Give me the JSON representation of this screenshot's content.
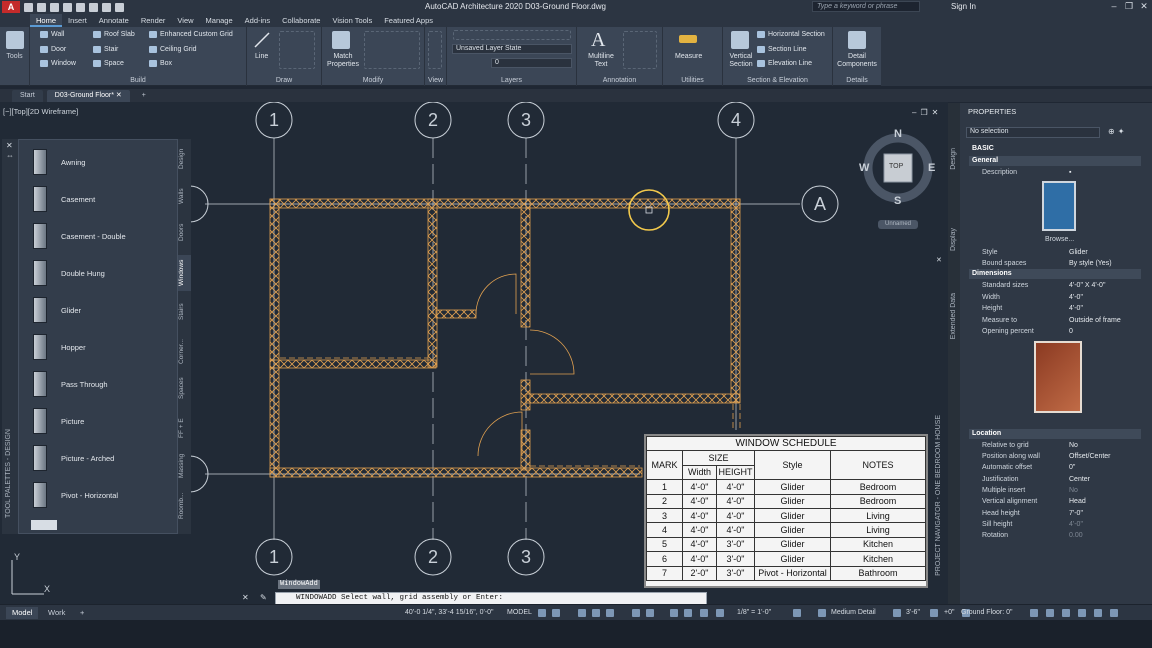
{
  "app": {
    "logo": "A",
    "title": "AutoCAD Architecture 2020   D03-Ground Floor.dwg",
    "search_placeholder": "Type a keyword or phrase",
    "sign_in": "Sign In"
  },
  "menu_tabs": [
    "Home",
    "Insert",
    "Annotate",
    "Render",
    "View",
    "Manage",
    "Add-ins",
    "Collaborate",
    "Vision Tools",
    "Featured Apps"
  ],
  "ribbon": {
    "tools_label": "Tools",
    "build": {
      "label": "Build",
      "items": [
        "Wall",
        "Door",
        "Window",
        "Roof Slab",
        "Stair",
        "Space",
        "Enhanced Custom Grid",
        "Ceiling Grid",
        "Box"
      ]
    },
    "draw": {
      "label": "Draw",
      "line": "Line"
    },
    "modify": {
      "label": "Modify",
      "match": "Match Properties"
    },
    "view": {
      "label": "View"
    },
    "layers": {
      "label": "Layers",
      "layer_state": "Unsaved Layer State",
      "layer_current": "0"
    },
    "annotation": {
      "label": "Annotation",
      "multiline": "Multiline Text"
    },
    "utilities": {
      "label": "Utilities",
      "measure": "Measure"
    },
    "section": {
      "label": "Section & Elevation",
      "vertical": "Vertical Section",
      "items": [
        "Horizontal Section",
        "Section Line",
        "Elevation Line"
      ]
    },
    "details": {
      "label": "Details",
      "detail": "Detail Components"
    }
  },
  "doc_tabs": [
    "Start",
    "D03-Ground Floor*"
  ],
  "viewport_label": "[−][Top][2D Wireframe]",
  "viewcube": {
    "n": "N",
    "s": "S",
    "e": "E",
    "w": "W",
    "top": "TOP",
    "ucs": "Unnamed"
  },
  "grid": {
    "top": [
      "1",
      "2",
      "3",
      "4"
    ],
    "bottom": [
      "1",
      "2",
      "3"
    ],
    "side": [
      "A"
    ]
  },
  "palette": {
    "items": [
      "Awning",
      "Casement",
      "Casement - Double",
      "Double Hung",
      "Glider",
      "Hopper",
      "Pass Through",
      "Picture",
      "Picture - Arched",
      "Pivot - Horizontal"
    ],
    "tabs": [
      "Design",
      "Walls",
      "Doors",
      "Windows",
      "Stairs",
      "Corner...",
      "Spaces",
      "FF + E",
      "Massing",
      "Roomb..."
    ],
    "side_title": "TOOL PALETTES - DESIGN"
  },
  "properties": {
    "title": "PROPERTIES",
    "selection": "No selection",
    "basic": "BASIC",
    "general": "General",
    "description_k": "Description",
    "browse": "Browse...",
    "style_k": "Style",
    "style_v": "Glider",
    "bound_k": "Bound spaces",
    "bound_v": "By style (Yes)",
    "dimensions": "Dimensions",
    "std_k": "Standard sizes",
    "std_v": "4'-0\" X 4'-0\"",
    "width_k": "Width",
    "width_v": "4'-0\"",
    "height_k": "Height",
    "height_v": "4'-0\"",
    "measure_k": "Measure to",
    "measure_v": "Outside of frame",
    "opening_k": "Opening percent",
    "opening_v": "0",
    "location": "Location",
    "rel_k": "Relative to grid",
    "rel_v": "No",
    "pos_k": "Position along wall",
    "pos_v": "Offset/Center",
    "auto_k": "Automatic offset",
    "auto_v": "0\"",
    "just_k": "Justification",
    "just_v": "Center",
    "multi_k": "Multiple insert",
    "multi_v": "No",
    "valign_k": "Vertical alignment",
    "valign_v": "Head",
    "head_k": "Head height",
    "head_v": "7'-0\"",
    "sill_k": "Sill height",
    "sill_v": "4'-0\"",
    "rot_k": "Rotation",
    "rot_v": "0.00",
    "side_tabs": [
      "Design",
      "Display",
      "Extended Data"
    ],
    "navigator": "PROJECT NAVIGATOR - ONE BEDROOM HOUSE"
  },
  "schedule": {
    "title": "WINDOW SCHEDULE",
    "mark": "MARK",
    "size": "SIZE",
    "width": "Width",
    "height": "HEIGHT",
    "style": "Style",
    "notes": "NOTES",
    "rows": [
      [
        "1",
        "4'-0\"",
        "4'-0\"",
        "Glider",
        "Bedroom"
      ],
      [
        "2",
        "4'-0\"",
        "4'-0\"",
        "Glider",
        "Bedroom"
      ],
      [
        "3",
        "4'-0\"",
        "4'-0\"",
        "Glider",
        "Living"
      ],
      [
        "4",
        "4'-0\"",
        "4'-0\"",
        "Glider",
        "Living"
      ],
      [
        "5",
        "4'-0\"",
        "3'-0\"",
        "Glider",
        "Kitchen"
      ],
      [
        "6",
        "4'-0\"",
        "3'-0\"",
        "Glider",
        "Kitchen"
      ],
      [
        "7",
        "2'-0\"",
        "3'-0\"",
        "Pivot - Horizontal",
        "Bathroom"
      ]
    ]
  },
  "command": {
    "label": "WindowAdd",
    "line": "WINDOWADD Select wall, grid assembly or Enter:"
  },
  "ucs": {
    "x": "X",
    "y": "Y"
  },
  "status": {
    "tabs": [
      "Model",
      "Work"
    ],
    "coords": "40'-0 1/4\", 33'-4 15/16\", 0'-0\"",
    "model": "MODEL",
    "scale": "1/8\" = 1'-0\"",
    "detail": "Medium Detail",
    "cut": "3'-6\"",
    "elev": "+0\"",
    "floor": "Ground Floor: 0\""
  },
  "colors": {
    "wall": "#e0a050",
    "grid": "#c9d0d8",
    "highlight": "#f2c94c",
    "bg": "#212a36"
  }
}
